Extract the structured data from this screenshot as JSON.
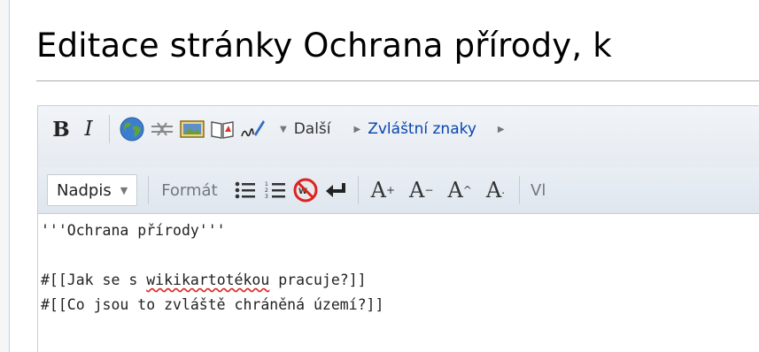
{
  "page": {
    "title": "Editace stránky Ochrana přírody, k"
  },
  "toolbar": {
    "bold_label": "B",
    "italic_label": "I",
    "more_label": "Další",
    "special_chars_label": "Zvláštní znaky"
  },
  "toolbar2": {
    "heading_select": "Nadpis",
    "format_label": "Formát",
    "insert_label": "Vl"
  },
  "editor": {
    "lines": [
      "'''Ochrana přírody'''",
      "",
      "#[[Jak se s ",
      "wikikartotékou",
      " pracuje?]]",
      "#[[Co jsou to zvláště chráněná území?]]"
    ]
  }
}
